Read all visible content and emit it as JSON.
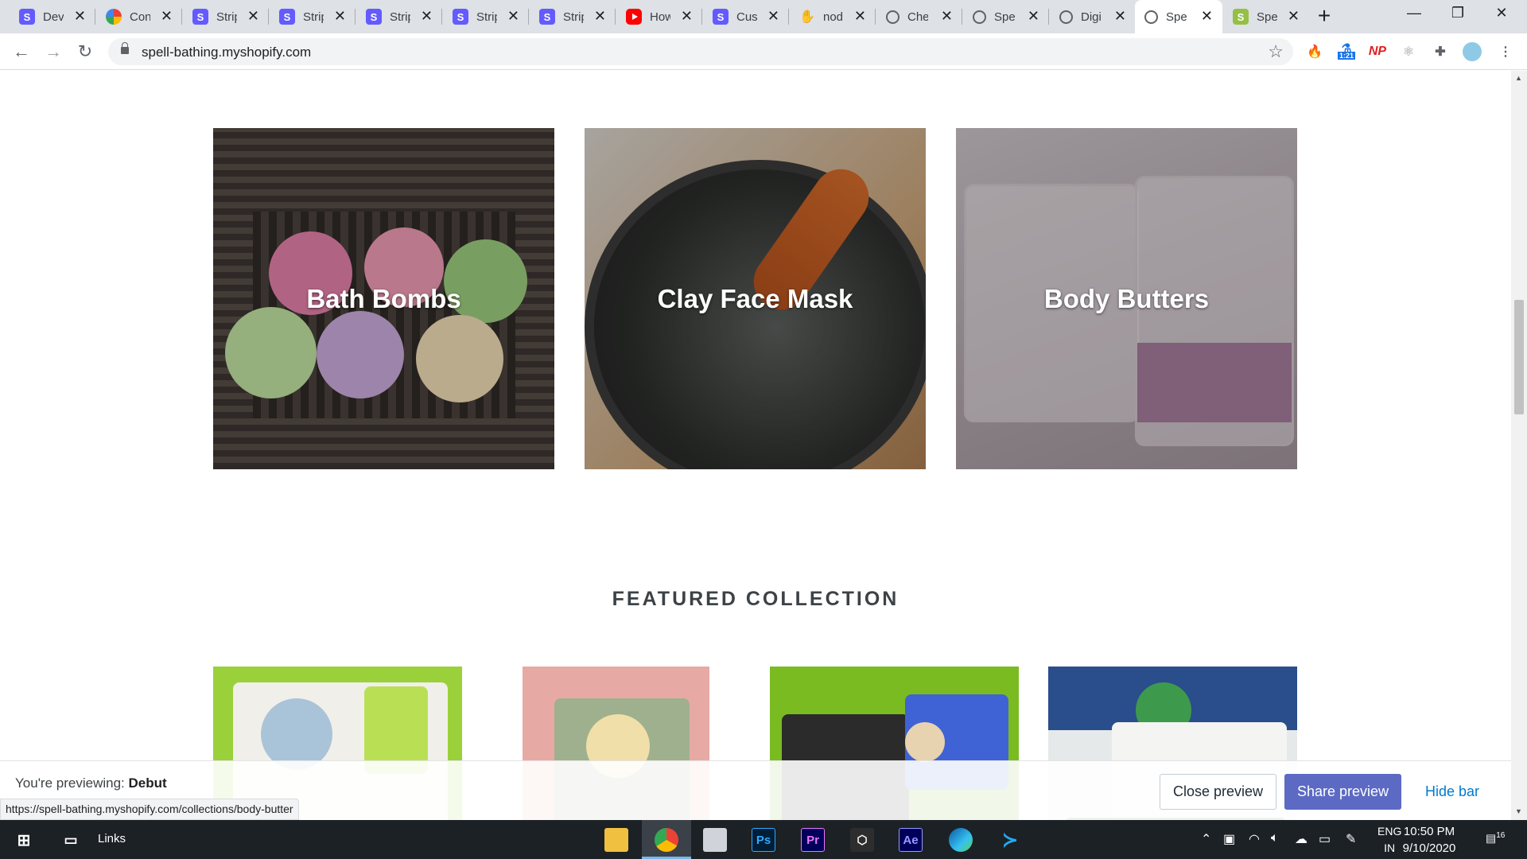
{
  "browser": {
    "tabs": [
      {
        "label": "Devi",
        "icon": "stripe-icon"
      },
      {
        "label": "Cont",
        "icon": "colorful-icon"
      },
      {
        "label": "Strip",
        "icon": "stripe-icon"
      },
      {
        "label": "Strip",
        "icon": "stripe-icon"
      },
      {
        "label": "Strip",
        "icon": "stripe-icon"
      },
      {
        "label": "Strip",
        "icon": "stripe-icon"
      },
      {
        "label": "Strip",
        "icon": "stripe-icon"
      },
      {
        "label": "How",
        "icon": "youtube-icon"
      },
      {
        "label": "Cust",
        "icon": "stripe-icon"
      },
      {
        "label": "nod",
        "icon": "node-icon"
      },
      {
        "label": "Chec",
        "icon": "globe-icon"
      },
      {
        "label": "Spel",
        "icon": "globe-icon"
      },
      {
        "label": "Digi",
        "icon": "globe-icon"
      },
      {
        "label": "Spel",
        "icon": "globe-icon"
      },
      {
        "label": "Spel",
        "icon": "shopify-icon"
      }
    ],
    "active_tab_index": 13,
    "stripe_letter": "S",
    "shopify_letter": "S",
    "new_tab": "+",
    "close_glyph": "✕",
    "url": "spell-bathing.myshopify.com",
    "extensions": {
      "ext_badge": "1:21",
      "np_label": "NP"
    }
  },
  "page": {
    "collections": [
      {
        "title": "Bath Bombs"
      },
      {
        "title": "Clay Face Mask"
      },
      {
        "title": "Body Butters"
      }
    ],
    "featured_heading": "FEATURED COLLECTION",
    "preview_bar": {
      "prefix": "You're previewing: ",
      "theme": "Debut",
      "close_label": "Close preview",
      "share_label": "Share preview",
      "hide_label": "Hide bar"
    },
    "status_url": "https://spell-bathing.myshopify.com/collections/body-butter"
  },
  "taskbar": {
    "links_label": "Links",
    "apps": [
      "file-explorer",
      "chrome",
      "mail",
      "photoshop",
      "premiere",
      "app",
      "after-effects",
      "edge",
      "vscode"
    ],
    "ps": "Ps",
    "pr": "Pr",
    "ae": "Ae",
    "lang_line1": "ENG",
    "lang_line2": "IN",
    "time": "10:50 PM",
    "date": "9/10/2020",
    "notif_count": "16"
  },
  "colors": {
    "share_button": "#5c6ac4",
    "hide_link": "#007ace",
    "stripe": "#635bff"
  }
}
